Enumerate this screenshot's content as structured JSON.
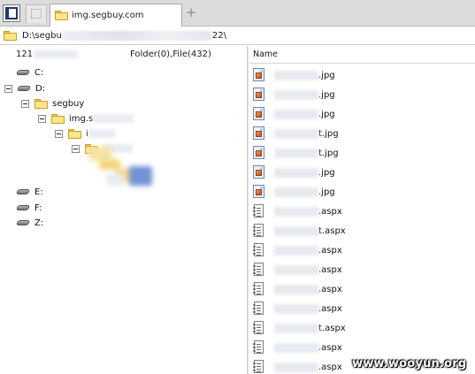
{
  "tab": {
    "title": "img.segbuy.com"
  },
  "address": {
    "path_start": "D:\\segbu",
    "path_end": "22\\"
  },
  "summary": {
    "count": "121",
    "folders_files": "Folder(0),File(432)"
  },
  "list_header": {
    "name_column": "Name"
  },
  "tree": {
    "drive_c": "C:",
    "drive_d": "D:",
    "segbuy": "segbuy",
    "img_sub": "img.s",
    "sub_i": "i",
    "drive_e": "E:",
    "drive_f": "F:",
    "drive_z": "Z:"
  },
  "files": [
    {
      "suffix": ".jpg",
      "icon": "image-file-icon"
    },
    {
      "suffix": ".jpg",
      "icon": "image-file-icon"
    },
    {
      "suffix": ".jpg",
      "icon": "image-file-icon"
    },
    {
      "suffix": "t.jpg",
      "icon": "image-file-icon"
    },
    {
      "suffix": "t.jpg",
      "icon": "image-file-icon"
    },
    {
      "suffix": ".jpg",
      "icon": "image-file-icon"
    },
    {
      "suffix": ".jpg",
      "icon": "image-file-icon"
    },
    {
      "suffix": ".aspx",
      "icon": "text-file-icon"
    },
    {
      "suffix": "t.aspx",
      "icon": "text-file-icon"
    },
    {
      "suffix": ".aspx",
      "icon": "text-file-icon"
    },
    {
      "suffix": ".aspx",
      "icon": "text-file-icon"
    },
    {
      "suffix": ".aspx",
      "icon": "text-file-icon"
    },
    {
      "suffix": ".aspx",
      "icon": "text-file-icon"
    },
    {
      "suffix": "t.aspx",
      "icon": "text-file-icon"
    },
    {
      "suffix": ".aspx",
      "icon": "text-file-icon"
    },
    {
      "suffix": ".aspx",
      "icon": "text-file-icon"
    }
  ],
  "watermark": "www.wooyun.org",
  "colors": {
    "folder": "#fde589",
    "selection_blur": "#6f93d6"
  }
}
